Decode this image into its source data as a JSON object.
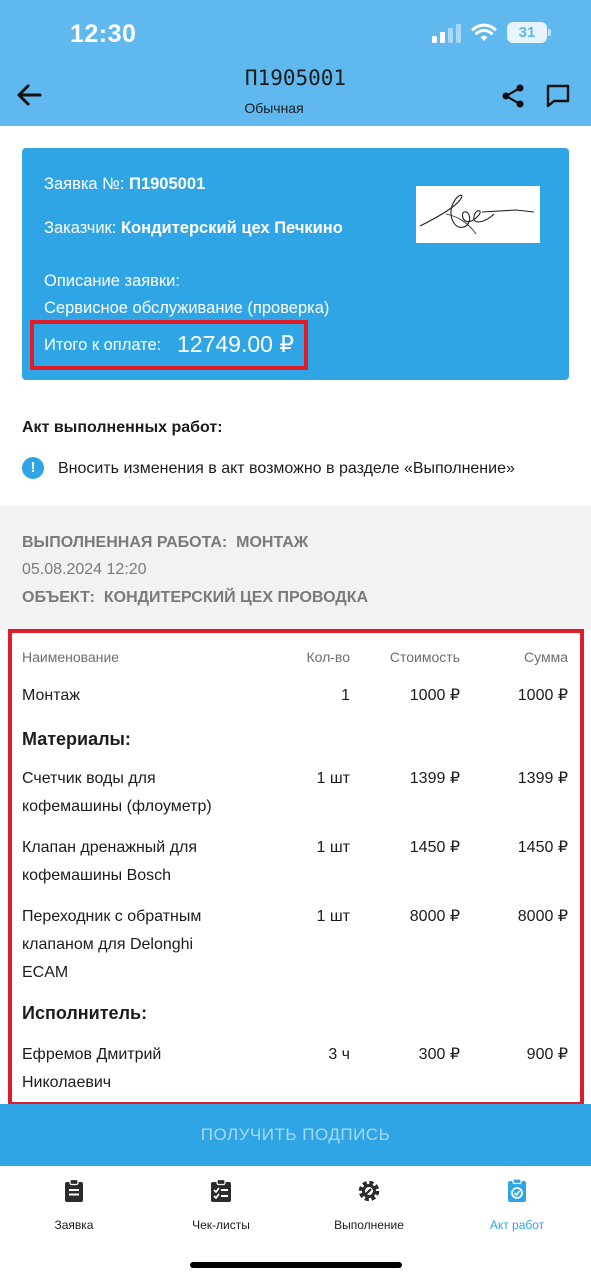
{
  "status_bar": {
    "time": "12:30",
    "battery": "31"
  },
  "nav": {
    "title": "П1905001",
    "subtitle": "Обычная",
    "back_icon": "arrow-left-icon",
    "share_icon": "share-icon",
    "chat_icon": "chat-icon"
  },
  "order": {
    "number_label": "Заявка №:",
    "number": "П1905001",
    "customer_label": "Заказчик:",
    "customer": "Кондитерский цех Печкино",
    "description_label": "Описание заявки:",
    "description": "Сервисное обслуживание (проверка)",
    "total_label": "Итого к оплате:",
    "total": "12749.00 ₽"
  },
  "act": {
    "title": "Акт выполненных работ:",
    "info": "Вносить изменения в акт возможно в разделе «Выполнение»"
  },
  "work": {
    "type_label": "ВЫПОЛНЕННАЯ РАБОТА:",
    "type": "МОНТАЖ",
    "datetime": "05.08.2024 12:20",
    "object_label": "ОБЪЕКТ:",
    "object": "КОНДИТЕРСКИЙ ЦЕХ ПРОВОДКА"
  },
  "table": {
    "headers": {
      "name": "Наименование",
      "qty": "Кол-во",
      "cost": "Стоимость",
      "sum": "Сумма"
    },
    "work_row": {
      "name": "Монтаж",
      "qty": "1",
      "cost": "1000 ₽",
      "sum": "1000 ₽"
    },
    "materials_title": "Материалы:",
    "materials": [
      {
        "name_l1": "Счетчик воды для",
        "name_l2": "кофемашины (флоуметр)",
        "qty": "1 шт",
        "cost": "1399 ₽",
        "sum": "1399 ₽"
      },
      {
        "name_l1": "Клапан дренажный для",
        "name_l2": "кофемашины Bosch",
        "qty": "1 шт",
        "cost": "1450 ₽",
        "sum": "1450 ₽"
      },
      {
        "name_l1": "Переходник с обратным",
        "name_l2": "клапаном для Delonghi",
        "name_l3": "ECAM",
        "qty": "1 шт",
        "cost": "8000 ₽",
        "sum": "8000 ₽"
      }
    ],
    "executor_title": "Исполнитель:",
    "executor": {
      "name_l1": "Ефремов Дмитрий",
      "name_l2": "Николаевич",
      "qty": "3 ч",
      "cost": "300 ₽",
      "sum": "900 ₽"
    }
  },
  "sign_button": "ПОЛУЧИТЬ ПОДПИСЬ",
  "tabs": [
    {
      "label": "Заявка",
      "icon": "clipboard-icon",
      "active": false
    },
    {
      "label": "Чек-листы",
      "icon": "checklist-icon",
      "active": false
    },
    {
      "label": "Выполнение",
      "icon": "gear-wrench-icon",
      "active": false
    },
    {
      "label": "Акт работ",
      "icon": "act-icon",
      "active": true
    }
  ],
  "colors": {
    "header": "#5fb8ee",
    "accent": "#2fa5e6",
    "highlight": "#e01b2a"
  }
}
